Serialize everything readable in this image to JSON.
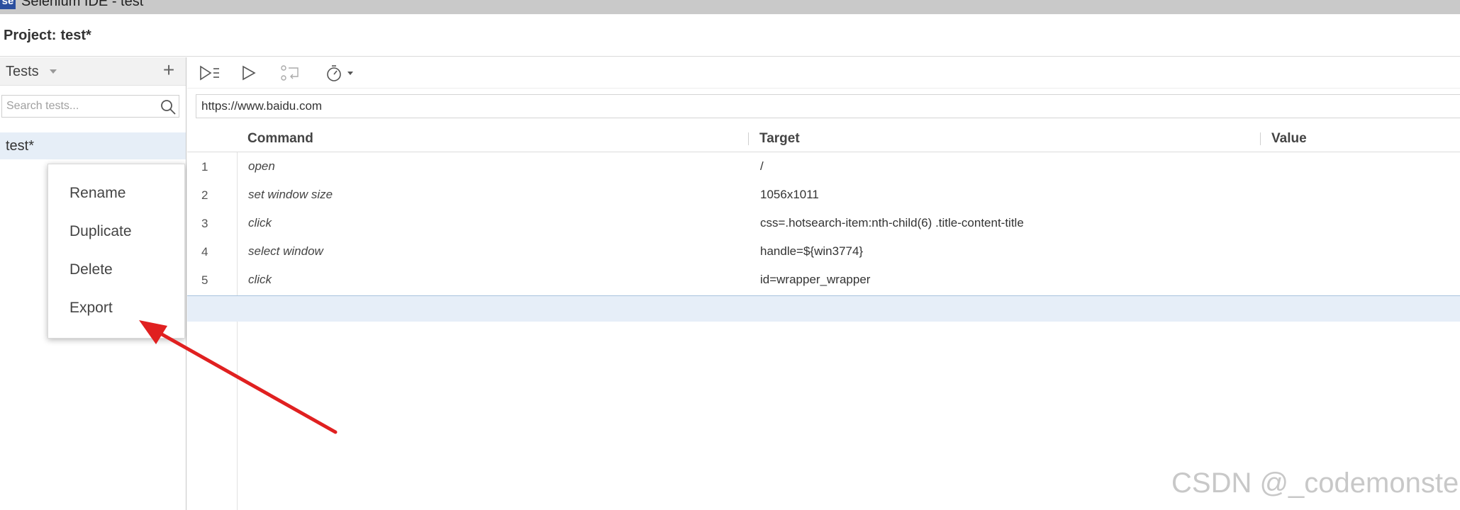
{
  "window": {
    "app_logo": "se",
    "title": "Selenium IDE - test"
  },
  "project": {
    "label": "Project:",
    "name": "test*"
  },
  "sidebar": {
    "header_title": "Tests",
    "add_label": "+",
    "search_placeholder": "Search tests...",
    "tests": [
      {
        "name": "test*",
        "selected": true
      }
    ]
  },
  "context_menu": {
    "items": [
      {
        "label": "Rename"
      },
      {
        "label": "Duplicate"
      },
      {
        "label": "Delete"
      },
      {
        "label": "Export"
      }
    ]
  },
  "toolbar": {
    "buttons": [
      "run-all-tests-icon",
      "run-current-test-icon",
      "step-over-icon",
      "speed-timer-icon"
    ]
  },
  "base_url": "https://www.baidu.com",
  "table": {
    "headers": {
      "command": "Command",
      "target": "Target",
      "value": "Value"
    },
    "rows": [
      {
        "num": "1",
        "command": "open",
        "target": "/",
        "value": ""
      },
      {
        "num": "2",
        "command": "set window size",
        "target": "1056x1011",
        "value": ""
      },
      {
        "num": "3",
        "command": "click",
        "target": "css=.hotsearch-item:nth-child(6) .title-content-title",
        "value": ""
      },
      {
        "num": "4",
        "command": "select window",
        "target": "handle=${win3774}",
        "value": ""
      },
      {
        "num": "5",
        "command": "click",
        "target": "id=wrapper_wrapper",
        "value": ""
      }
    ]
  },
  "annotation": {
    "arrow_color": "#e02020"
  },
  "watermark": "CSDN @_codemonster"
}
